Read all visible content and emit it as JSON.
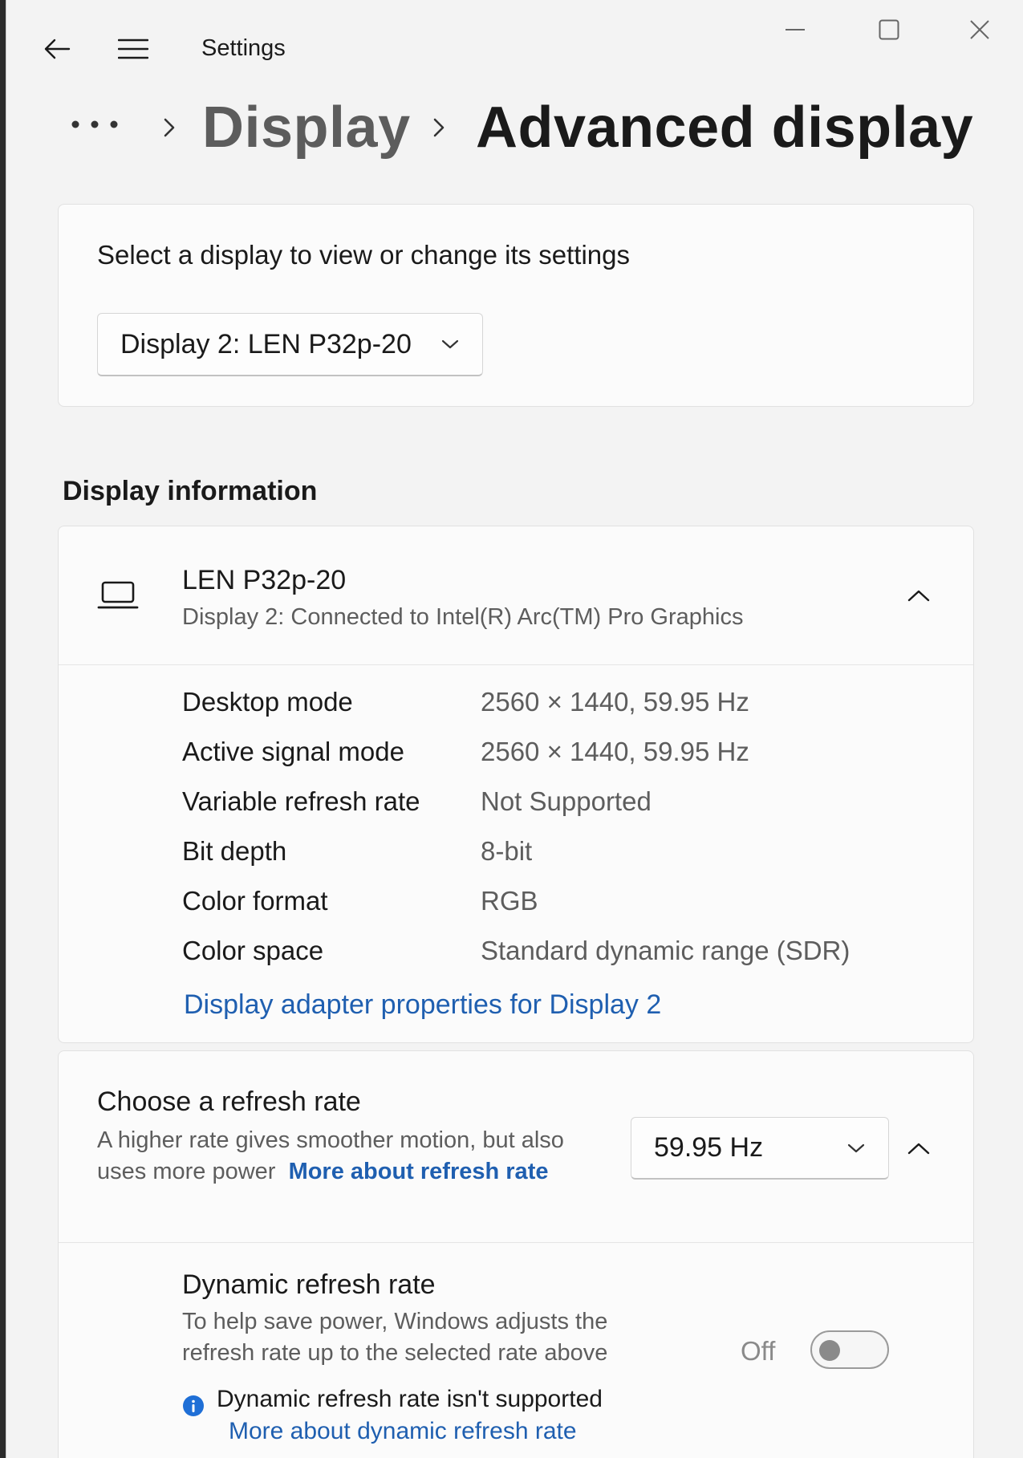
{
  "window": {
    "title": "Settings"
  },
  "breadcrumb": {
    "parent": "Display",
    "current": "Advanced display"
  },
  "select_display": {
    "label": "Select a display to view or change its settings",
    "selected": "Display 2: LEN P32p-20"
  },
  "display_info": {
    "section_title": "Display information",
    "monitor_name": "LEN P32p-20",
    "monitor_subtitle": "Display 2: Connected to Intel(R) Arc(TM) Pro Graphics",
    "rows": [
      {
        "label": "Desktop mode",
        "value": "2560 × 1440, 59.95 Hz"
      },
      {
        "label": "Active signal mode",
        "value": "2560 × 1440, 59.95 Hz"
      },
      {
        "label": "Variable refresh rate",
        "value": "Not Supported"
      },
      {
        "label": "Bit depth",
        "value": "8-bit"
      },
      {
        "label": "Color format",
        "value": "RGB"
      },
      {
        "label": "Color space",
        "value": "Standard dynamic range (SDR)"
      }
    ],
    "adapter_link": "Display adapter properties for Display 2"
  },
  "refresh_rate": {
    "title": "Choose a refresh rate",
    "description": "A higher rate gives smoother motion, but also uses more power",
    "more_link": "More about refresh rate",
    "selected": "59.95 Hz"
  },
  "dynamic_refresh": {
    "title": "Dynamic refresh rate",
    "description": "To help save power, Windows adjusts the refresh rate up to the selected rate above",
    "toggle_state": "Off",
    "warning": "Dynamic refresh rate isn't supported",
    "more_link": "More about dynamic refresh rate"
  },
  "colors": {
    "accent_link": "#1f5fb0",
    "info_icon": "#1f6fd6"
  },
  "icons": {
    "back": "back-arrow-icon",
    "menu": "hamburger-menu-icon",
    "minimize": "minimize-icon",
    "maximize": "maximize-icon",
    "close": "close-icon",
    "monitor": "laptop-icon",
    "info": "info-icon"
  }
}
